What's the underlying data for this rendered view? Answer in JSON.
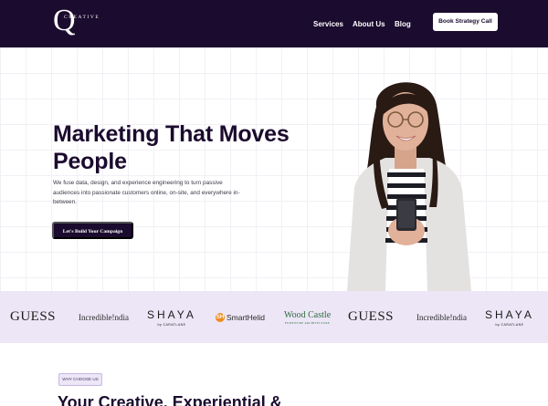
{
  "nav": {
    "logo_letter": "Q",
    "logo_word": "CREATIVE",
    "links": [
      "Services",
      "About Us",
      "Blog"
    ],
    "cta": "Book Strategy Call"
  },
  "hero": {
    "headline_line1": "Marketing That Moves",
    "headline_line2": "People",
    "subtext": "We fuse data, design, and experience engineering to turn passive audiences into passionate customers online, on-site, and everywhere in-between.",
    "cta": "Let's Build Your Campaign"
  },
  "brands": {
    "guess": "GUESS",
    "incredible": "Incredible!ndia",
    "shaya": "SHAYA",
    "shaya_by": "by CARATLANE",
    "smart": "SmartHelid",
    "smart_mark": "SH",
    "wood": "Wood Castle",
    "wood_sub": "FURNITURE ARCHITECTURE"
  },
  "why": {
    "badge": "WHY CHOOSE US",
    "title": "Your Creative, Experiential &"
  },
  "colors": {
    "navy": "#1b0b2e",
    "lavender": "#ece6f6",
    "accent_orange": "#f08a1c",
    "wood_green": "#2e6b3c"
  }
}
